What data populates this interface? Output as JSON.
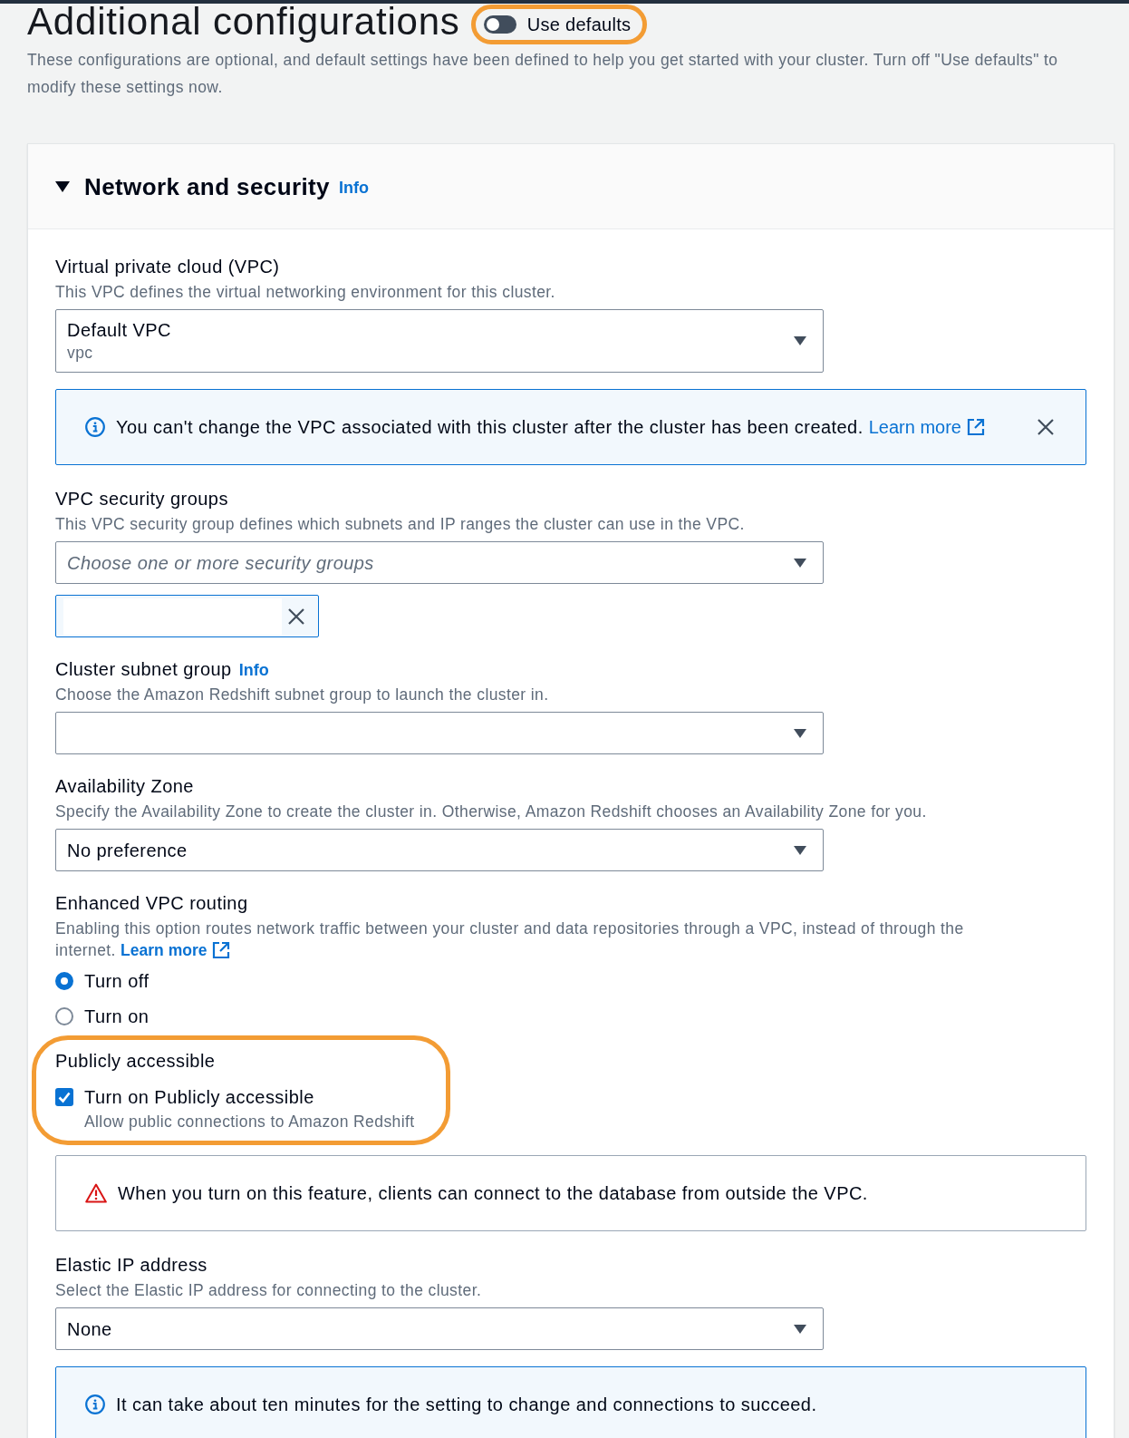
{
  "page": {
    "title": "Additional configurations",
    "use_defaults": {
      "label": "Use defaults",
      "on": false,
      "highlighted": true
    },
    "description": "These configurations are optional, and default settings have been defined to help you get started with your cluster. Turn off \"Use defaults\" to modify these settings now."
  },
  "section": {
    "title": "Network and security",
    "info": "Info",
    "expanded": true,
    "fields": [
      {
        "kind": "select",
        "label": "Virtual private cloud (VPC)",
        "description": "This VPC defines the virtual networking environment for this cluster.",
        "value": "Default VPC",
        "secondary": "vpc"
      },
      {
        "kind": "info_alert",
        "text": "You can't change the VPC associated with this cluster after the cluster has been created.",
        "link": "Learn more",
        "dismissible": true
      },
      {
        "kind": "multiselect",
        "label": "VPC security groups",
        "description": "This VPC security group defines which subnets and IP ranges the cluster can use in the VPC.",
        "placeholder": "Choose one or more security groups",
        "tokens": [
          {
            "removable": true
          }
        ]
      },
      {
        "kind": "select",
        "label": "Cluster subnet group",
        "info": "Info",
        "description": "Choose the Amazon Redshift subnet group to launch the cluster in."
      },
      {
        "kind": "select",
        "label": "Availability Zone",
        "description": "Specify the Availability Zone to create the cluster in. Otherwise, Amazon Redshift chooses an Availability Zone for you.",
        "value": "No preference"
      },
      {
        "kind": "radio_group",
        "label": "Enhanced VPC routing",
        "description": "Enabling this option routes network traffic between your cluster and data repositories through a VPC, instead of through the internet.",
        "link": "Learn more",
        "options": [
          {
            "label": "Turn off",
            "selected": true
          },
          {
            "label": "Turn on",
            "selected": false
          }
        ]
      },
      {
        "kind": "checkbox",
        "label": "Publicly accessible",
        "highlighted": true,
        "option": {
          "label": "Turn on Publicly accessible",
          "description": "Allow public connections to Amazon Redshift",
          "checked": true
        }
      },
      {
        "kind": "warning_alert",
        "text": "When you turn on this feature, clients can connect to the database from outside the VPC.",
        "dismissible": false
      },
      {
        "kind": "select",
        "label": "Elastic IP address",
        "description": "Select the Elastic IP address for connecting to the cluster.",
        "value": "None"
      },
      {
        "kind": "info_alert",
        "text": "It can take about ten minutes for the setting to change and connections to succeed.",
        "dismissible": false
      }
    ]
  }
}
